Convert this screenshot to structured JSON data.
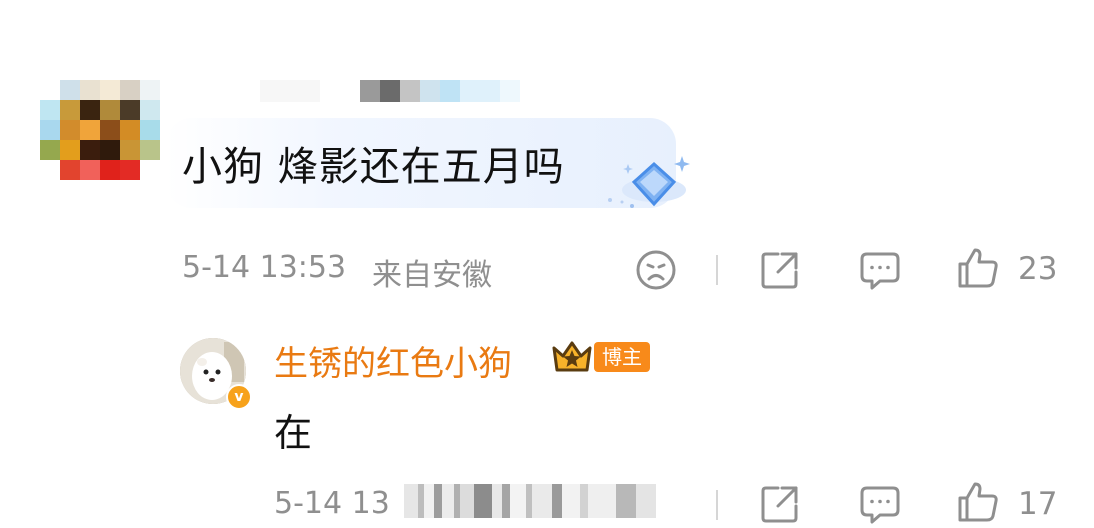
{
  "comment": {
    "text": "小狗 烽影还在五月吗",
    "time": "5-14 13:53",
    "location": "来自安徽",
    "likes": "23"
  },
  "reply": {
    "author": "生锈的红色小狗",
    "badge": "博主",
    "text": "在",
    "time_partial": "5-14 13",
    "likes": "17"
  },
  "icons": {
    "dislike": "sad-face-icon",
    "share": "share-icon",
    "comment": "comment-icon",
    "like": "thumbs-up-icon",
    "verified": "verified-v-icon",
    "crown": "crown-badge-icon"
  },
  "colors": {
    "author_name": "#e97a12",
    "badge_bg": "#f88a1a",
    "meta_text": "#8f8f8f"
  }
}
